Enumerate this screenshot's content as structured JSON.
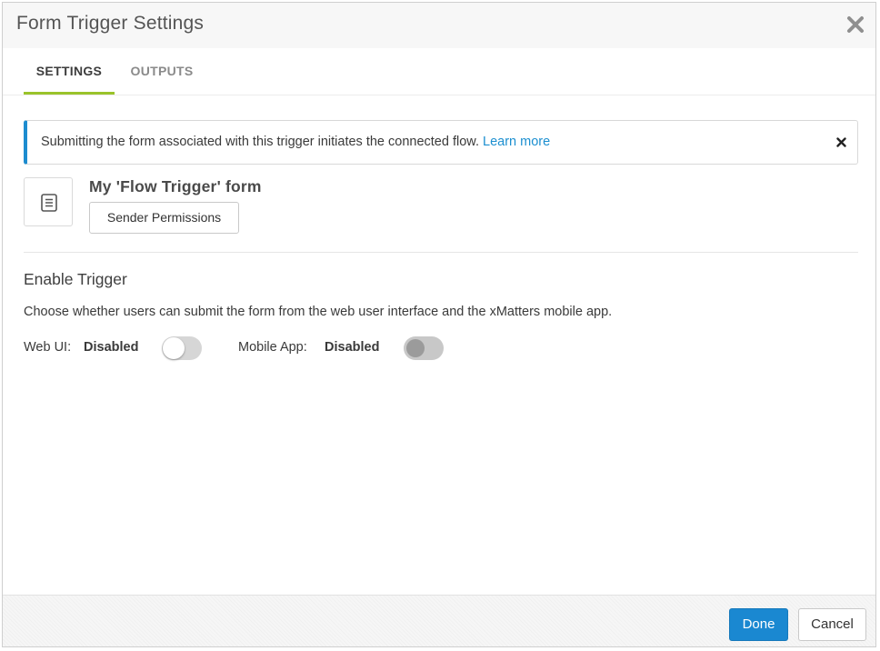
{
  "dialog": {
    "title": "Form Trigger Settings"
  },
  "tabs": [
    {
      "label": "SETTINGS",
      "active": true
    },
    {
      "label": "OUTPUTS",
      "active": false
    }
  ],
  "banner": {
    "text": "Submitting the form associated with this trigger initiates the connected flow.",
    "link_label": "Learn more"
  },
  "form": {
    "name": "My 'Flow Trigger' form",
    "permissions_button": "Sender Permissions",
    "icon": "document-icon"
  },
  "enable_trigger": {
    "title": "Enable Trigger",
    "description": "Choose whether users can submit the form from the web user interface and the xMatters mobile app.",
    "web_ui": {
      "label": "Web UI:",
      "status": "Disabled",
      "enabled": false
    },
    "mobile_app": {
      "label": "Mobile App:",
      "status": "Disabled",
      "enabled": false
    }
  },
  "footer": {
    "done_label": "Done",
    "cancel_label": "Cancel"
  },
  "colors": {
    "accent_blue": "#1a88d1",
    "tab_underline": "#9ac32a",
    "link": "#1c8fd0"
  }
}
